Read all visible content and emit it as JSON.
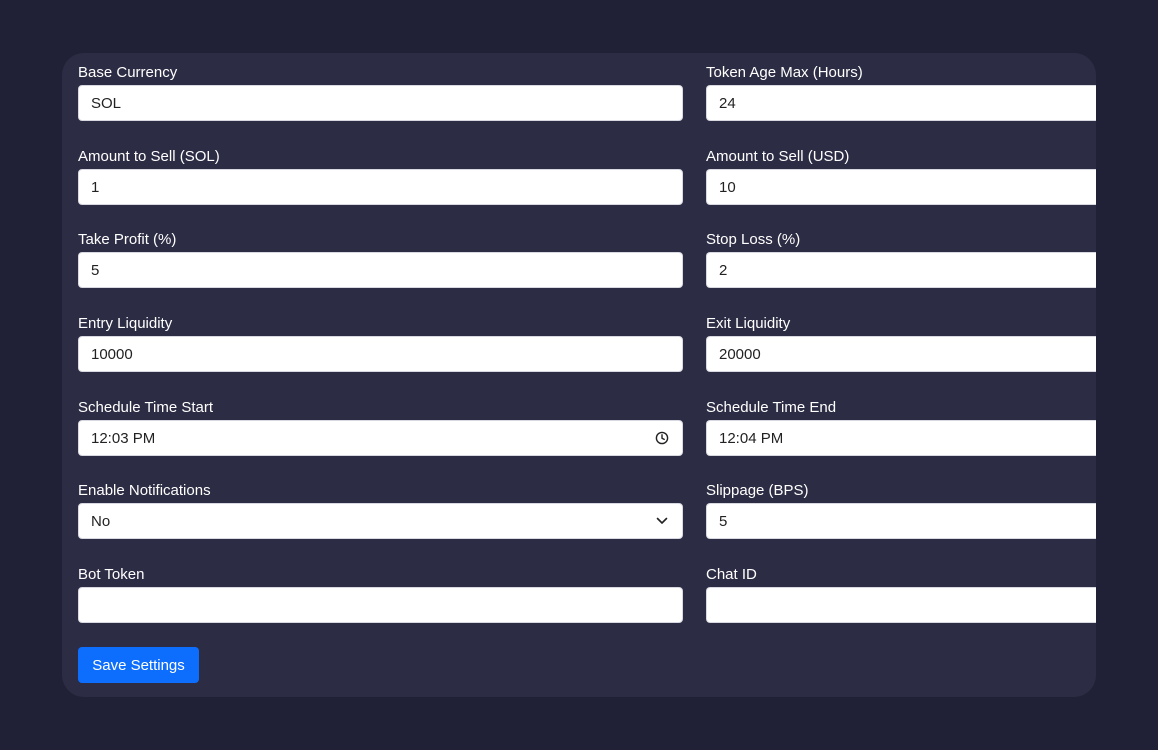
{
  "form": {
    "fields": {
      "base_currency": {
        "label": "Base Currency",
        "value": "SOL"
      },
      "token_age_max": {
        "label": "Token Age Max (Hours)",
        "value": "24"
      },
      "amount_sell_sol": {
        "label": "Amount to Sell (SOL)",
        "value": "1"
      },
      "amount_sell_usd": {
        "label": "Amount to Sell (USD)",
        "value": "10"
      },
      "take_profit": {
        "label": "Take Profit (%)",
        "value": "5"
      },
      "stop_loss": {
        "label": "Stop Loss (%)",
        "value": "2"
      },
      "entry_liquidity": {
        "label": "Entry Liquidity",
        "value": "10000"
      },
      "exit_liquidity": {
        "label": "Exit Liquidity",
        "value": "20000"
      },
      "schedule_start": {
        "label": "Schedule Time Start",
        "value": "12:03 PM",
        "icon": "clock-icon"
      },
      "schedule_end": {
        "label": "Schedule Time End",
        "value": "12:04 PM"
      },
      "enable_notifications": {
        "label": "Enable Notifications",
        "value": "No",
        "icon": "chevron-down-icon"
      },
      "slippage": {
        "label": "Slippage (BPS)",
        "value": "5"
      },
      "bot_token": {
        "label": "Bot Token",
        "value": ""
      },
      "chat_id": {
        "label": "Chat ID",
        "value": ""
      }
    },
    "save_label": "Save Settings"
  },
  "colors": {
    "page_background": "#202036",
    "card_background": "#2c2c44",
    "button": "#0d6efd",
    "label_text": "#ffffff"
  }
}
